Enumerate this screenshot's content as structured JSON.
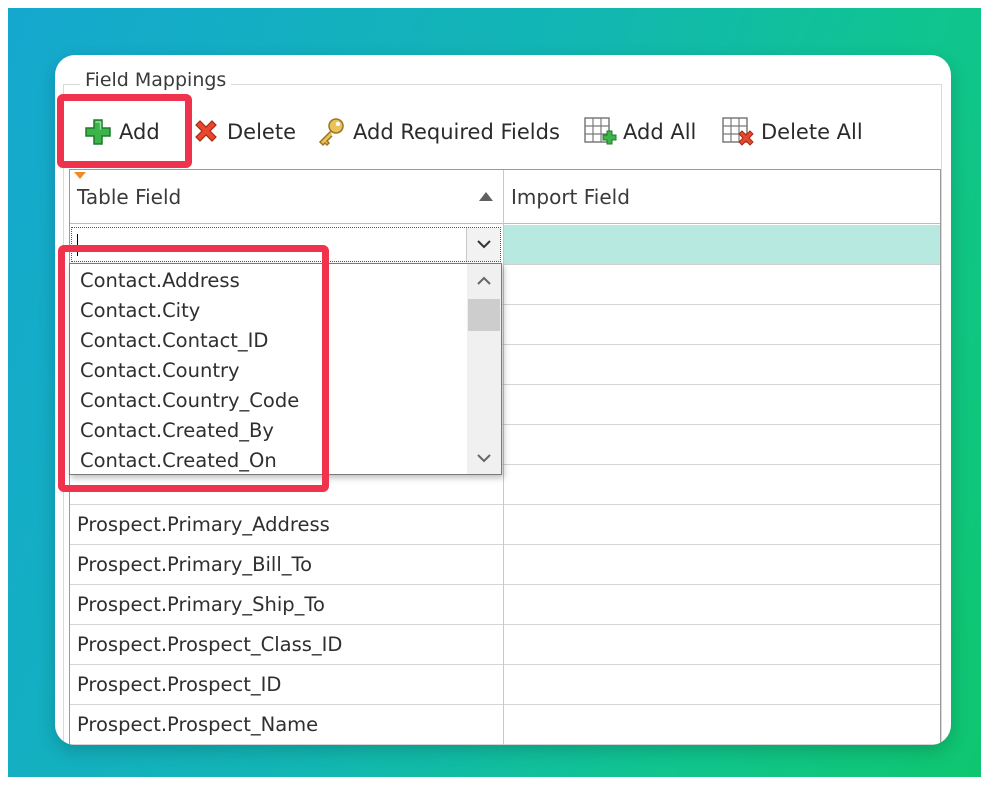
{
  "group_title": "Field Mappings",
  "toolbar": {
    "add_label": "Add",
    "delete_label": "Delete",
    "add_required_label": "Add Required Fields",
    "add_all_label": "Add All",
    "delete_all_label": "Delete All"
  },
  "grid": {
    "columns": [
      "Table Field",
      "Import Field"
    ],
    "rows": [
      {
        "table_field": "Prospect.Primary_Address",
        "import_field": ""
      },
      {
        "table_field": "Prospect.Primary_Bill_To",
        "import_field": ""
      },
      {
        "table_field": "Prospect.Primary_Ship_To",
        "import_field": ""
      },
      {
        "table_field": "Prospect.Prospect_Class_ID",
        "import_field": ""
      },
      {
        "table_field": "Prospect.Prospect_ID",
        "import_field": ""
      },
      {
        "table_field": "Prospect.Prospect_Name",
        "import_field": ""
      }
    ]
  },
  "dropdown": {
    "items": [
      "Contact.Address",
      "Contact.City",
      "Contact.Contact_ID",
      "Contact.Country",
      "Contact.Country_Code",
      "Contact.Created_By",
      "Contact.Created_On"
    ]
  },
  "colors": {
    "highlight": "#f0334d",
    "edit_row": "#b8e9e0",
    "add_icon": "#3bb54a",
    "delete_icon": "#e8472e"
  }
}
